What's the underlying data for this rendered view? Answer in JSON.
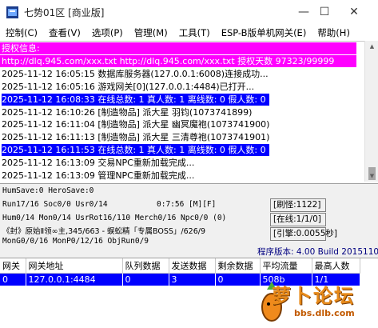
{
  "window": {
    "title": "七势01区 [商业版]",
    "minimize_glyph": "—",
    "maximize_glyph": "☐",
    "close_glyph": "✕"
  },
  "menu": [
    "控制(C)",
    "查看(V)",
    "选项(P)",
    "管理(M)",
    "工具(T)",
    "ESP-B版单机网关(E)",
    "帮助(H)"
  ],
  "log": {
    "lines": [
      {
        "text": "授权信息:",
        "style": "magenta"
      },
      {
        "text": "http://dlq.945.com/xxx.txt http://dlq.945.com/xxx.txt 授权天数 97323/99999",
        "style": "magenta"
      },
      {
        "text": "2025-11-12 16:05:15 数据库服务器(127.0.0.1:6008)连接成功...",
        "style": "normal"
      },
      {
        "text": "2025-11-12 16:05:16 游戏网关[0](127.0.0.1:4484)已打开...",
        "style": "normal"
      },
      {
        "text": "2025-11-12 16:08:33 在线总数: 1 真人数: 1 离线数: 0 假人数: 0",
        "style": "blue"
      },
      {
        "text": "2025-11-12 16:10:26 [制造物品] 派大星 羽钧(1073741899)",
        "style": "normal"
      },
      {
        "text": "2025-11-12 16:11:04 [制造物品] 派大星 幽冥魔袍(1073741900)",
        "style": "normal"
      },
      {
        "text": "2025-11-12 16:11:13 [制造物品] 派大星 三清尊袍(1073741901)",
        "style": "normal"
      },
      {
        "text": "2025-11-12 16:11:53 在线总数: 1 真人数: 1 离线数: 0 假人数: 0",
        "style": "blue"
      },
      {
        "text": "2025-11-12 16:13:09 交易NPC重新加载完成...",
        "style": "normal"
      },
      {
        "text": "2025-11-12 16:13:09 管理NPC重新加载完成...",
        "style": "normal"
      }
    ]
  },
  "status": {
    "line1": "HumSave:0 HeroSave:0",
    "line2": "Run17/16 Soc0/0 Usr0/14",
    "timer": "0:7:56 [M][F]",
    "line3": "Hum0/14 Mon0/14 UsrRot16/110 Merch0/16 Npc0/0 (0)",
    "line4": "《封》原始Ⅱ领∞主,345/663 - 蜈蚣精「专属BOSS」/626/9",
    "line5": "MonG0/0/16 MonP0/12/16 ObjRun0/9",
    "refresh": "[刷怪:1122]",
    "online": "[在线:1/1/0]",
    "engine": "[引擎:0.0055秒]",
    "version": "程序版本: 4.00 Build 20151104"
  },
  "table": {
    "headers": [
      "网关",
      "网关地址",
      "队列数据",
      "发送数据",
      "剩余数据",
      "平均流量",
      "最高人数"
    ],
    "rows": [
      [
        "0",
        "127.0.0.1:4484",
        "0",
        "3",
        "0",
        "508b",
        "1/1"
      ]
    ]
  },
  "watermark": {
    "title": "萝卜论坛",
    "url": "bbs.dlb.com"
  }
}
